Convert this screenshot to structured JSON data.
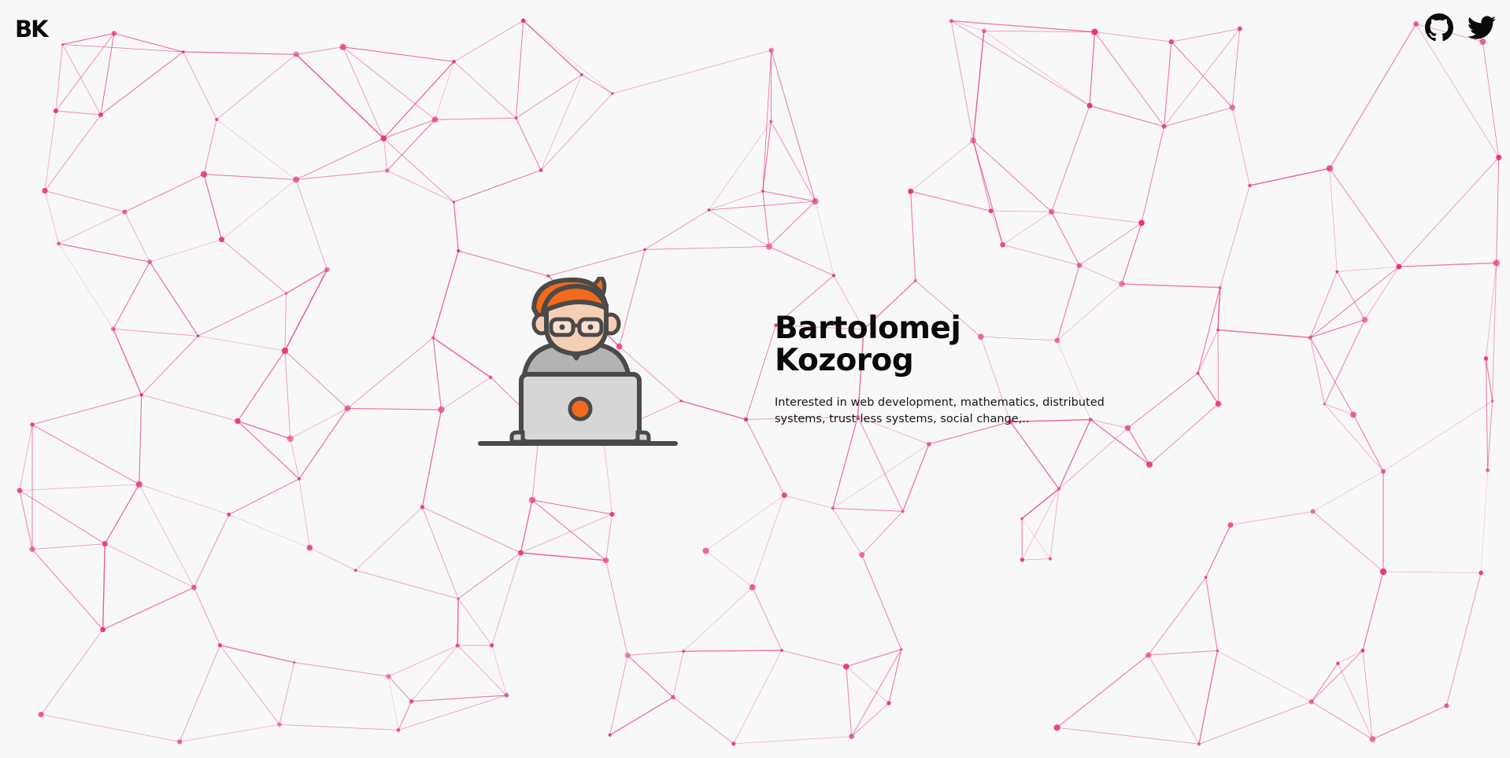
{
  "page": {
    "logo": "BK",
    "social": [
      {
        "name": "GitHub",
        "icon": "github-icon"
      },
      {
        "name": "Twitter",
        "icon": "twitter-icon"
      }
    ]
  },
  "hero": {
    "name_line1": "Bartolomej",
    "name_line2": "Kozorog",
    "bio": "Interested in web development, mathematics, distributed systems, trust-less systems, social change,..",
    "avatar_icon": "developer-at-laptop-icon"
  },
  "colors": {
    "background": "#f8f8f8",
    "network": "#e8336b",
    "text": "#0a0a0a",
    "accent_hair": "#f26a1b",
    "outline": "#4a4a4a"
  }
}
